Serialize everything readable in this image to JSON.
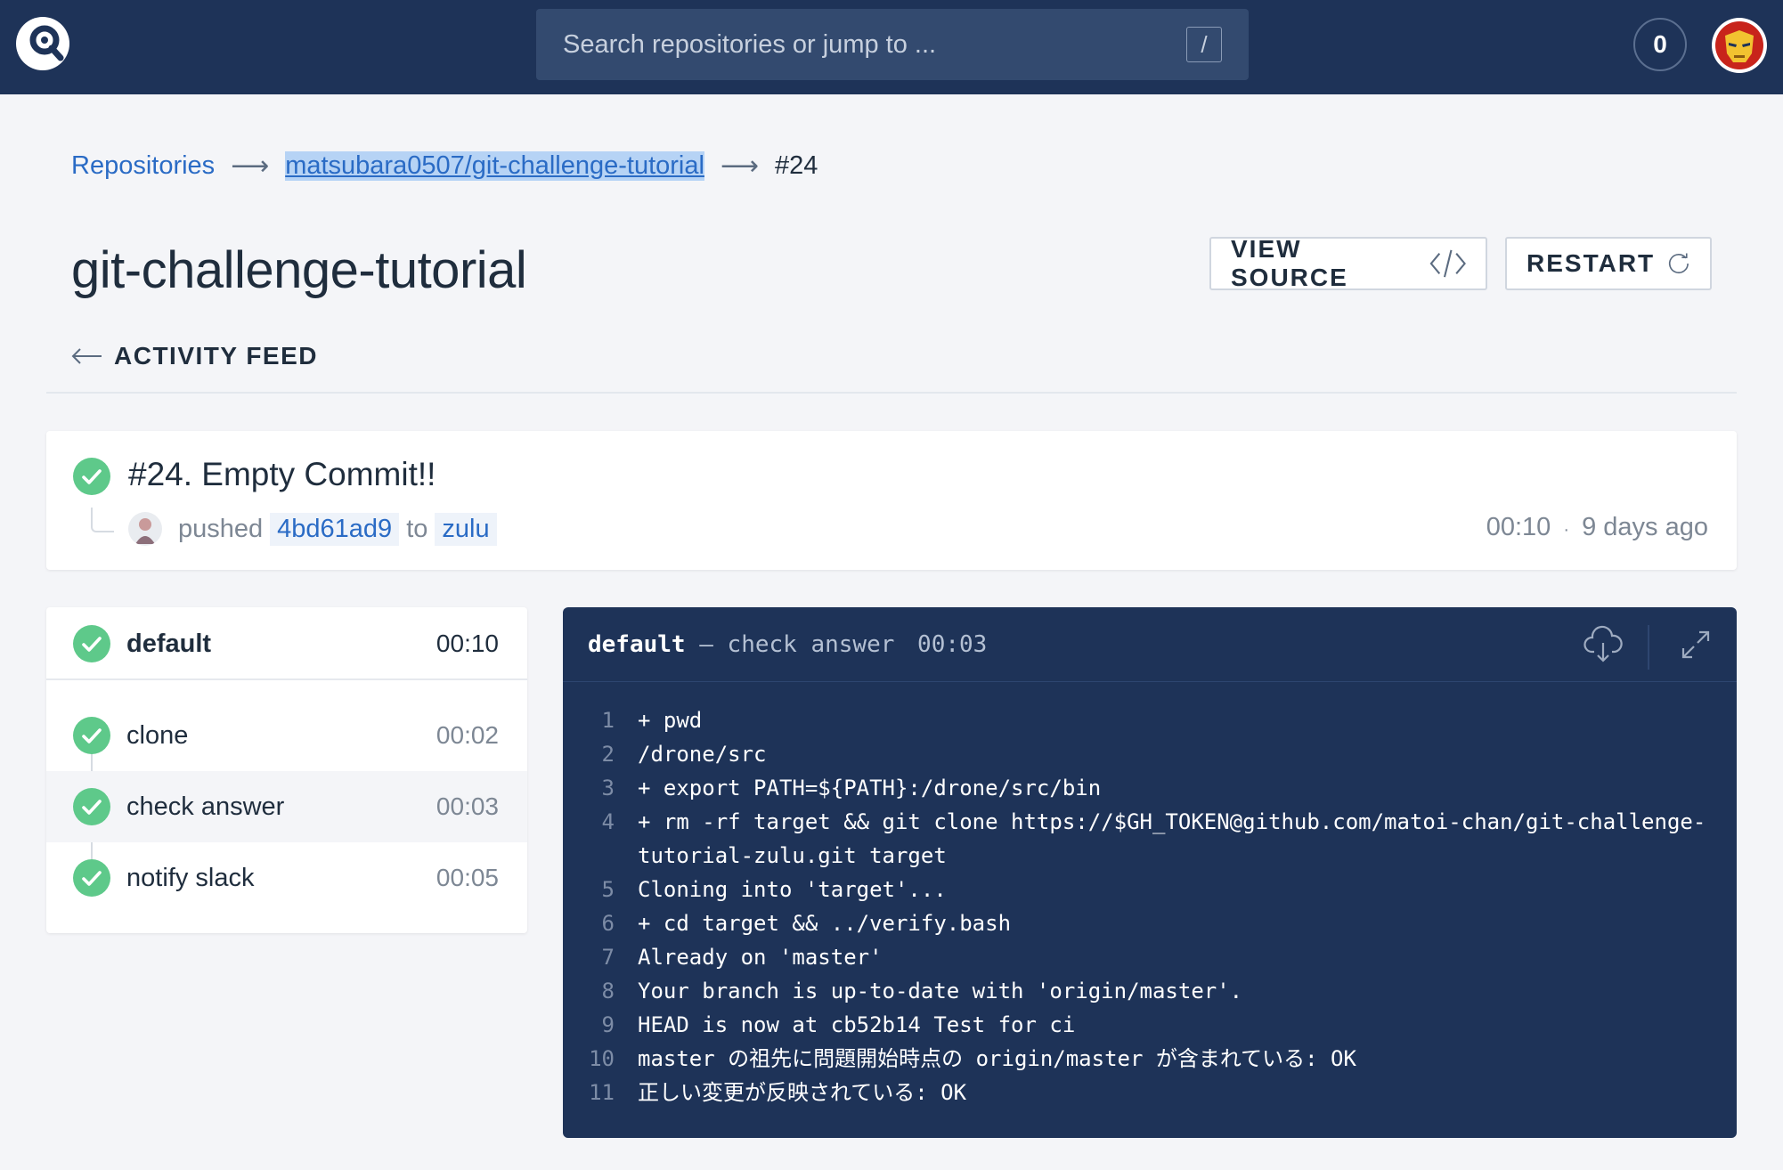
{
  "nav": {
    "search_placeholder": "Search repositories or jump to ...",
    "search_shortcut": "/",
    "counter": "0"
  },
  "breadcrumb": {
    "root": "Repositories",
    "repo": "matsubara0507/git-challenge-tutorial",
    "current": "#24"
  },
  "page": {
    "title": "git-challenge-tutorial",
    "view_source_label": "VIEW SOURCE",
    "restart_label": "RESTART",
    "back_label": "ACTIVITY FEED"
  },
  "build": {
    "title": "#24. Empty Commit!!",
    "action": "pushed",
    "commit": "4bd61ad9",
    "to_word": "to",
    "branch": "zulu",
    "duration": "00:10",
    "separator": "·",
    "age": "9 days ago",
    "status": "success"
  },
  "stages": {
    "name": "default",
    "duration": "00:10",
    "steps": [
      {
        "name": "clone",
        "duration": "00:02",
        "status": "success"
      },
      {
        "name": "check answer",
        "duration": "00:03",
        "status": "success",
        "active": true
      },
      {
        "name": "notify slack",
        "duration": "00:05",
        "status": "success"
      }
    ]
  },
  "log": {
    "stage": "default",
    "dash": "–",
    "step": "check answer",
    "duration": "00:03",
    "download_icon": "cloud-download-icon",
    "expand_icon": "expand-icon",
    "lines": [
      {
        "num": "1",
        "text": "+ pwd"
      },
      {
        "num": "2",
        "text": "/drone/src"
      },
      {
        "num": "3",
        "text": "+ export PATH=${PATH}:/drone/src/bin"
      },
      {
        "num": "4",
        "text": "+ rm -rf target && git clone https://$GH_TOKEN@github.com/matoi-chan/git-challenge-tutorial-zulu.git target"
      },
      {
        "num": "5",
        "text": "Cloning into 'target'..."
      },
      {
        "num": "6",
        "text": "+ cd target && ../verify.bash"
      },
      {
        "num": "7",
        "text": "Already on 'master'"
      },
      {
        "num": "8",
        "text": "Your branch is up-to-date with 'origin/master'."
      },
      {
        "num": "9",
        "text": "HEAD is now at cb52b14 Test for ci"
      },
      {
        "num": "10",
        "text": "master の祖先に問題開始時点の origin/master が含まれている: OK"
      },
      {
        "num": "11",
        "text": "正しい変更が反映されている: OK"
      }
    ]
  },
  "colors": {
    "nav_bg": "#1e3358",
    "success": "#5ec98a",
    "link": "#2a6bc5"
  }
}
